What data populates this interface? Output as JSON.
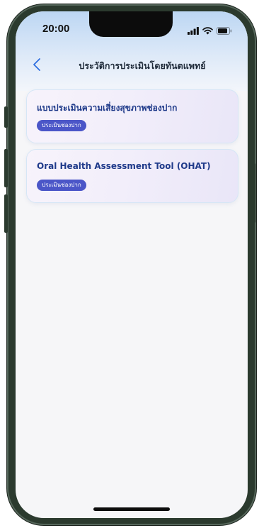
{
  "status_bar": {
    "time": "20:00",
    "icons": [
      "cellular-signal-icon",
      "wifi-icon",
      "battery-icon"
    ]
  },
  "header": {
    "title": "ประวัติการประเมินโดยทันตแพทย์",
    "back_icon": "chevron-left-icon"
  },
  "assessments": [
    {
      "title": "แบบประเมินความเสี่ยงสุขภาพช่องปาก",
      "tag": "ประเมินช่องปาก"
    },
    {
      "title": "Oral Health Assessment Tool (OHAT)",
      "tag": "ประเมินช่องปาก"
    }
  ],
  "colors": {
    "header_gradient_top": "#bcd6f3",
    "card_title": "#1f3a8a",
    "tag_background": "#4b56c8",
    "phone_frame": "#2b3a2e"
  }
}
